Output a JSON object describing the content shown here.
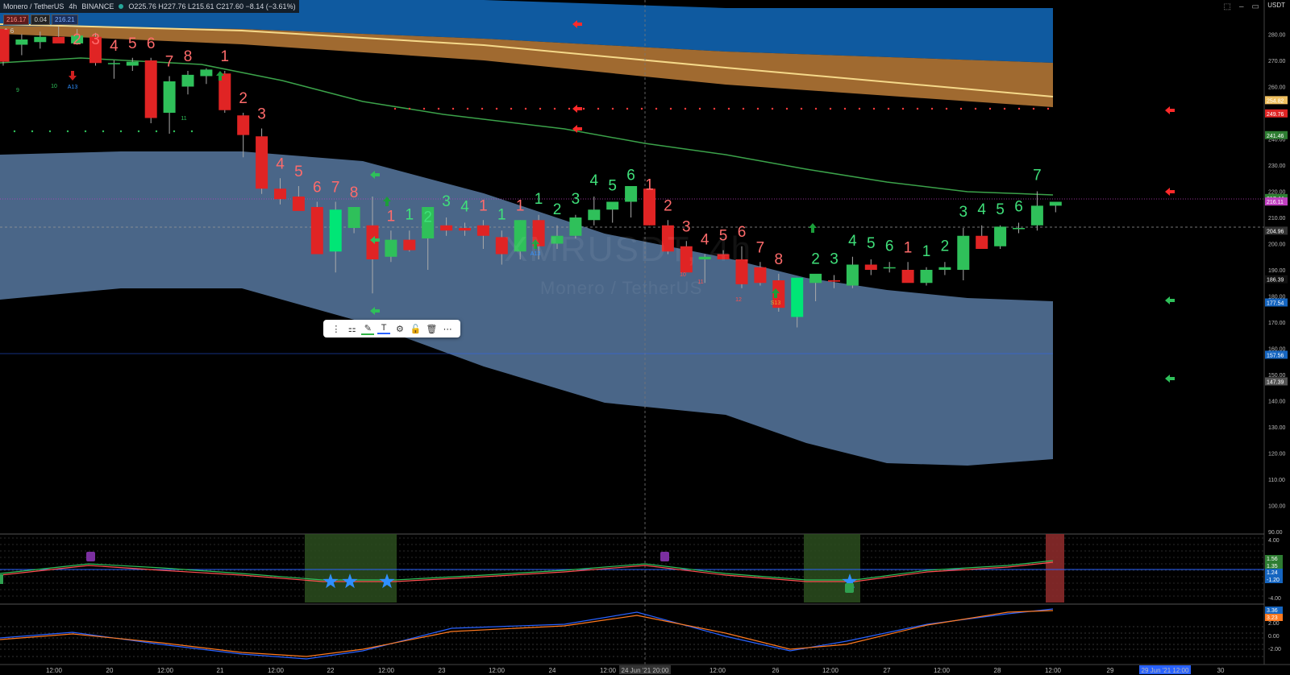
{
  "header": {
    "symbol": "Monero / TetherUS",
    "interval": "4h",
    "exchange": "BINANCE",
    "ohlc": "O225.76 H227.76 L215.61 C217.60 −8.14 (−3.61%)",
    "bid": "216.17",
    "spread": "0.04",
    "ask": "216.21",
    "legend_value": "6"
  },
  "currency": "USDT",
  "watermark": {
    "symbol": "XMRUSDT, 4h",
    "name": "Monero / TetherUS"
  },
  "toolbar": {
    "items": [
      "drag-handle",
      "template-icon",
      "pencil-icon",
      "text-icon",
      "gear-icon",
      "lock-icon",
      "trash-icon",
      "more-icon"
    ]
  },
  "colors": {
    "up": "#2fc05a",
    "up_bright": "#00e676",
    "down": "#e02424",
    "cloud_blue": "#0f5aa0",
    "cloud_orange": "#a06a30",
    "band_fill": "#4a6688",
    "ema_green": "#3ba24a",
    "count_red": "#ff6b6b",
    "count_green": "#3fe07a"
  },
  "chart_data": {
    "type": "candlestick",
    "title": "XMRUSDT, 4h",
    "ylim": [
      90,
      290
    ],
    "y_ticks": [
      90,
      100,
      110,
      120,
      130,
      140,
      150,
      160,
      170,
      180,
      190,
      200,
      210,
      220,
      230,
      240,
      250,
      260,
      270,
      280
    ],
    "x_ticks": [
      "12:00",
      "20",
      "12:00",
      "21",
      "12:00",
      "22",
      "12:00",
      "23",
      "12:00",
      "24",
      "12:00",
      "24 Jun '21  20:00",
      "12:00",
      "26",
      "12:00",
      "27",
      "12:00",
      "28",
      "12:00",
      "29",
      "29 Jun '21  12:00",
      "30"
    ],
    "price_labels": [
      {
        "value": 254.82,
        "text": "254.82",
        "color": "#f0c060"
      },
      {
        "value": 249.76,
        "text": "249.76",
        "color": "#e02424"
      },
      {
        "value": 241.46,
        "text": "241.46",
        "color": "#2e7d32"
      },
      {
        "value": 217.44,
        "text": "217.44",
        "color": "#2e7d32"
      },
      {
        "value": 216.11,
        "text": "216.11",
        "color": "#c040c0"
      },
      {
        "value": 204.96,
        "text": "204.96",
        "color": "#333333"
      },
      {
        "value": 186.39,
        "text": "186.39",
        "color": "#111111"
      },
      {
        "value": 177.54,
        "text": "177.54",
        "color": "#1565c0"
      },
      {
        "value": 157.56,
        "text": "157.56",
        "color": "#1565c0"
      },
      {
        "value": 147.39,
        "text": "147.39",
        "color": "#555555"
      }
    ],
    "candles": [
      [
        282.0,
        282.0,
        268.0,
        269.5
      ],
      [
        276.0,
        280.0,
        272.0,
        278.0
      ],
      [
        277.0,
        281.0,
        274.5,
        279.0
      ],
      [
        279.0,
        283.0,
        277.0,
        276.5
      ],
      [
        276.5,
        282.0,
        276.0,
        279.5
      ],
      [
        279.0,
        280.5,
        268.0,
        269.0
      ],
      [
        269.0,
        270.0,
        263.0,
        269.0
      ],
      [
        268.0,
        271.0,
        266.0,
        269.5
      ],
      [
        270.0,
        271.0,
        246.0,
        248.0
      ],
      [
        250.0,
        264.0,
        242.0,
        262.0
      ],
      [
        260.0,
        266.0,
        257.0,
        264.5
      ],
      [
        264.0,
        267.0,
        261.0,
        266.5
      ],
      [
        265.0,
        266.0,
        250.0,
        251.0
      ],
      [
        249.0,
        250.0,
        233.0,
        241.5
      ],
      [
        241.0,
        244.0,
        219.0,
        221.0
      ],
      [
        221.0,
        225.0,
        215.0,
        217.0
      ],
      [
        218.0,
        222.0,
        213.0,
        212.5
      ],
      [
        214.0,
        216.0,
        196.0,
        196.0
      ],
      [
        197.0,
        216.0,
        189.0,
        213.0
      ],
      [
        206.0,
        214.0,
        204.0,
        214.0
      ],
      [
        207.0,
        218.0,
        181.0,
        194.0
      ],
      [
        195.0,
        205.0,
        193.0,
        201.5
      ],
      [
        201.5,
        205.0,
        197.0,
        197.5
      ],
      [
        202.0,
        204.0,
        190.0,
        214.0
      ],
      [
        207.0,
        210.0,
        203.0,
        205.0
      ],
      [
        206.0,
        208.0,
        203.0,
        205.0
      ],
      [
        207.0,
        209.0,
        198.0,
        203.0
      ],
      [
        202.5,
        205.0,
        192.0,
        196.0
      ],
      [
        197.0,
        209.0,
        194.0,
        209.0
      ],
      [
        209.0,
        211.0,
        194.0,
        199.0
      ],
      [
        200.0,
        207.0,
        198.0,
        203.0
      ],
      [
        203.0,
        211.0,
        202.0,
        210.0
      ],
      [
        209.0,
        218.0,
        207.0,
        213.0
      ],
      [
        213.0,
        216.0,
        208.0,
        216.0
      ],
      [
        216.0,
        220.0,
        210.0,
        222.0
      ],
      [
        221.0,
        217.0,
        207.0,
        207.0
      ],
      [
        207.0,
        209.0,
        196.0,
        197.0
      ],
      [
        199.0,
        201.0,
        189.0,
        189.0
      ],
      [
        194.0,
        196.0,
        185.0,
        195.0
      ],
      [
        196.0,
        197.5,
        194.0,
        194.0
      ],
      [
        194.0,
        199.0,
        183.0,
        184.5
      ],
      [
        191.0,
        193.0,
        184.0,
        185.0
      ],
      [
        186.0,
        188.5,
        174.0,
        175.5
      ],
      [
        172.0,
        187.0,
        168.0,
        187.0
      ],
      [
        185.0,
        188.0,
        178.0,
        188.5
      ],
      [
        186.0,
        188.0,
        183.0,
        185.5
      ],
      [
        184.0,
        195.0,
        183.0,
        192.0
      ],
      [
        192.0,
        194.0,
        188.0,
        190.0
      ],
      [
        191.0,
        193.0,
        189.0,
        191.0
      ],
      [
        190.0,
        193.0,
        187.0,
        185.0
      ],
      [
        185.0,
        191.0,
        184.0,
        190.0
      ],
      [
        190.0,
        193.0,
        188.0,
        191.0
      ],
      [
        190.0,
        206.0,
        186.0,
        203.0
      ],
      [
        203.0,
        207.0,
        200.0,
        198.0
      ],
      [
        199.0,
        207.0,
        198.0,
        206.5
      ],
      [
        206.0,
        208.0,
        204.0,
        206.0
      ],
      [
        207.0,
        220.0,
        205.0,
        214.5
      ],
      [
        214.5,
        216.0,
        212.0,
        216.0
      ]
    ],
    "sequence_labels": [
      {
        "i": 4,
        "t": "2",
        "c": "r"
      },
      {
        "i": 5,
        "t": "3",
        "c": "r"
      },
      {
        "i": 6,
        "t": "4",
        "c": "r"
      },
      {
        "i": 7,
        "t": "5",
        "c": "r"
      },
      {
        "i": 8,
        "t": "6",
        "c": "r"
      },
      {
        "i": 9,
        "t": "7",
        "c": "r"
      },
      {
        "i": 10,
        "t": "8",
        "c": "r"
      },
      {
        "i": 12,
        "t": "1",
        "c": "r"
      },
      {
        "i": 13,
        "t": "2",
        "c": "r"
      },
      {
        "i": 14,
        "t": "3",
        "c": "r"
      },
      {
        "i": 15,
        "t": "4",
        "c": "r"
      },
      {
        "i": 16,
        "t": "5",
        "c": "r"
      },
      {
        "i": 17,
        "t": "6",
        "c": "r"
      },
      {
        "i": 18,
        "t": "7",
        "c": "r"
      },
      {
        "i": 19,
        "t": "8",
        "c": "r"
      },
      {
        "i": 21,
        "t": "1",
        "c": "r"
      },
      {
        "i": 22,
        "t": "1",
        "c": "g"
      },
      {
        "i": 23,
        "t": "2",
        "c": "g"
      },
      {
        "i": 24,
        "t": "3",
        "c": "g"
      },
      {
        "i": 25,
        "t": "4",
        "c": "g"
      },
      {
        "i": 26,
        "t": "1",
        "c": "r"
      },
      {
        "i": 27,
        "t": "1",
        "c": "g"
      },
      {
        "i": 28,
        "t": "1",
        "c": "r"
      },
      {
        "i": 29,
        "t": "1",
        "c": "g"
      },
      {
        "i": 30,
        "t": "2",
        "c": "g"
      },
      {
        "i": 31,
        "t": "3",
        "c": "g"
      },
      {
        "i": 32,
        "t": "4",
        "c": "g"
      },
      {
        "i": 33,
        "t": "5",
        "c": "g"
      },
      {
        "i": 34,
        "t": "6",
        "c": "g"
      },
      {
        "i": 35,
        "t": "1",
        "c": "r"
      },
      {
        "i": 36,
        "t": "2",
        "c": "r"
      },
      {
        "i": 37,
        "t": "3",
        "c": "r"
      },
      {
        "i": 38,
        "t": "4",
        "c": "r"
      },
      {
        "i": 39,
        "t": "5",
        "c": "r"
      },
      {
        "i": 40,
        "t": "6",
        "c": "r"
      },
      {
        "i": 41,
        "t": "7",
        "c": "r"
      },
      {
        "i": 42,
        "t": "8",
        "c": "r"
      },
      {
        "i": 44,
        "t": "2",
        "c": "g"
      },
      {
        "i": 45,
        "t": "3",
        "c": "g"
      },
      {
        "i": 46,
        "t": "4",
        "c": "g"
      },
      {
        "i": 47,
        "t": "5",
        "c": "g"
      },
      {
        "i": 48,
        "t": "6",
        "c": "g"
      },
      {
        "i": 49,
        "t": "1",
        "c": "r"
      },
      {
        "i": 50,
        "t": "1",
        "c": "g"
      },
      {
        "i": 51,
        "t": "2",
        "c": "g"
      },
      {
        "i": 52,
        "t": "3",
        "c": "g"
      },
      {
        "i": 53,
        "t": "4",
        "c": "g"
      },
      {
        "i": 54,
        "t": "5",
        "c": "g"
      },
      {
        "i": 55,
        "t": "6",
        "c": "g"
      },
      {
        "i": 56,
        "t": "7",
        "c": "g"
      }
    ],
    "small_labels": [
      {
        "t": "9",
        "c": "g"
      },
      {
        "t": "10",
        "c": "g"
      },
      {
        "t": "A13",
        "c": "b"
      },
      {
        "t": "11",
        "c": "g"
      },
      {
        "t": "A13",
        "c": "b"
      },
      {
        "t": "S13",
        "c": "y"
      },
      {
        "t": "10",
        "c": "r"
      },
      {
        "t": "11",
        "c": "r"
      },
      {
        "t": "12",
        "c": "r"
      }
    ],
    "osc1": {
      "y_ticks": [
        "4.00",
        "-4.00"
      ],
      "labels": [
        "1.56",
        "1.35",
        "1.24",
        "-1.20"
      ]
    },
    "osc2": {
      "y_ticks": [
        "2.00",
        "0.00",
        "-2.00"
      ],
      "labels": [
        "3.36",
        "3.23"
      ]
    }
  }
}
